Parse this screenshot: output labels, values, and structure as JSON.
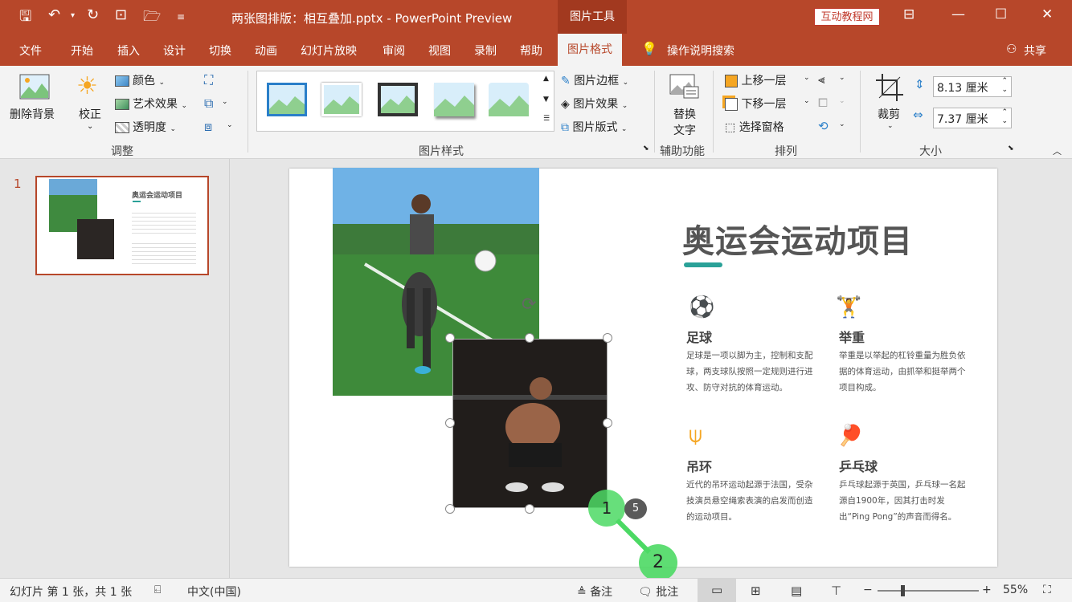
{
  "titlebar": {
    "title": "两张图排版：相互叠加.pptx  -  PowerPoint Preview",
    "context_tab": "图片工具",
    "tutorial_badge": "互动教程网"
  },
  "tabs": [
    "文件",
    "开始",
    "插入",
    "设计",
    "切换",
    "动画",
    "幻灯片放映",
    "审阅",
    "视图",
    "录制",
    "帮助",
    "图片格式"
  ],
  "active_tab": "图片格式",
  "tell_me": "操作说明搜索",
  "share": "共享",
  "ribbon": {
    "remove_bg": "删除背景",
    "corrections": "校正",
    "color": "颜色",
    "artistic": "艺术效果",
    "transparency": "透明度",
    "group_adjust": "调整",
    "border": "图片边框",
    "effects": "图片效果",
    "layout": "图片版式",
    "group_styles": "图片样式",
    "alt_text_1": "替换",
    "alt_text_2": "文字",
    "group_access": "辅助功能",
    "bring_forward": "上移一层",
    "send_backward": "下移一层",
    "selection_pane": "选择窗格",
    "group_arrange": "排列",
    "crop": "裁剪",
    "height": "8.13 厘米",
    "width": "7.37 厘米",
    "group_size": "大小"
  },
  "slide_number": "1",
  "slide": {
    "title": "奥运会运动项目",
    "items": [
      {
        "name": "足球",
        "desc": "足球是一项以脚为主，控制和支配球，两支球队按照一定规则进行进攻、防守对抗的体育运动。"
      },
      {
        "name": "举重",
        "desc": "举重是以举起的杠铃重量为胜负依据的体育运动，由抓举和挺举两个项目构成。"
      },
      {
        "name": "吊环",
        "desc": "近代的吊环运动起源于法国，受杂技演员悬空绳索表演的启发而创造的运动项目。"
      },
      {
        "name": "乒乓球",
        "desc": "乒乓球起源于英国，乒乓球一名起源自1900年，因其打击时发出“Ping Pong”的声音而得名。"
      }
    ]
  },
  "markers": {
    "step1": "1",
    "step2": "2",
    "badge": "5"
  },
  "status": {
    "slide_info": "幻灯片 第 1 张，共 1 张",
    "language": "中文(中国)",
    "notes": "备注",
    "comments": "批注",
    "zoom": "55%",
    "minus": "−",
    "plus": "+"
  },
  "colors": {
    "accent": "#b7472a",
    "teal": "#2aa198",
    "orange": "#f5a623",
    "red": "#d9534f",
    "marker_green": "#4cd964"
  }
}
